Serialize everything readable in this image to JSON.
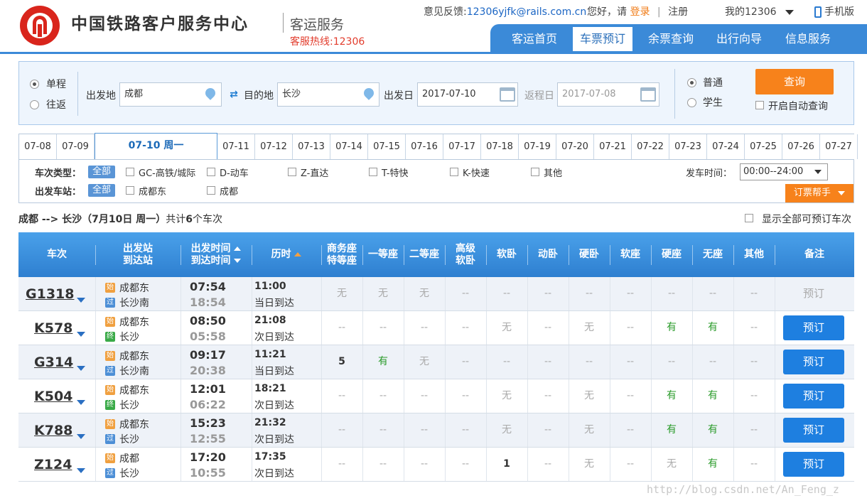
{
  "header": {
    "site_name": "中国铁路客户服务中心",
    "site_sub": "客运服务",
    "hotline": "客服热线:12306",
    "feedback_label": "意见反馈:",
    "feedback_email": "12306yjfk@rails.com.cn",
    "greeting": "您好，请",
    "login": "登录",
    "sep": "|",
    "register": "注册",
    "my": "我的12306",
    "mobile": "手机版",
    "nav": [
      "客运首页",
      "车票预订",
      "余票查询",
      "出行向导",
      "信息服务"
    ],
    "nav_active": 1
  },
  "query": {
    "single": "单程",
    "round": "往返",
    "from_label": "出发地",
    "from_value": "成都",
    "to_label": "目的地",
    "to_value": "长沙",
    "date_label": "出发日",
    "date_value": "2017-07-10",
    "return_label": "返程日",
    "return_value": "2017-07-08",
    "normal": "普通",
    "student": "学生",
    "search_btn": "查询",
    "auto_query": "开启自动查询"
  },
  "dates": [
    "07-08",
    "07-09",
    "07-10 周一",
    "07-11",
    "07-12",
    "07-13",
    "07-14",
    "07-15",
    "07-16",
    "07-17",
    "07-18",
    "07-19",
    "07-20",
    "07-21",
    "07-22",
    "07-23",
    "07-24",
    "07-25",
    "07-26",
    "07-27"
  ],
  "filters": {
    "type_label": "车次类型：",
    "all": "全部",
    "types": [
      "GC-高铁/城际",
      "D-动车",
      "Z-直达",
      "T-特快",
      "K-快速",
      "其他"
    ],
    "station_label": "出发车站：",
    "stations": [
      "成都东",
      "成都"
    ],
    "time_label": "发车时间：",
    "time_value": "00:00--24:00",
    "helper": "订票帮手"
  },
  "summary": {
    "route": "成都 --> 长沙",
    "date": "（7月10日  周一）",
    "count_pre": "共计",
    "count": "6",
    "count_post": "个车次",
    "show_all": "显示全部可预订车次"
  },
  "table": {
    "headers": {
      "train": "车次",
      "station1": "出发站",
      "station2": "到达站",
      "time1": "出发时间",
      "time2": "到达时间",
      "duration": "历时",
      "business1": "商务座",
      "business2": "特等座",
      "first": "一等座",
      "second": "二等座",
      "premium1": "高级",
      "premium2": "软卧",
      "soft_sleeper": "软卧",
      "dong_sleeper": "动卧",
      "hard_sleeper": "硬卧",
      "soft_seat": "软座",
      "hard_seat": "硬座",
      "no_seat": "无座",
      "other": "其他",
      "remark": "备注"
    },
    "rows": [
      {
        "no": "G1318",
        "from": "成都东",
        "to": "长沙南",
        "from_tag": "始",
        "to_tag": "过",
        "dep": "07:54",
        "arr": "18:54",
        "dur": "11:00",
        "day": "当日到达",
        "seats": [
          "无",
          "无",
          "无",
          "--",
          "--",
          "--",
          "--",
          "--",
          "--",
          "--",
          "--"
        ],
        "book": "预订",
        "bookable": false
      },
      {
        "no": "K578",
        "from": "成都东",
        "to": "长沙",
        "from_tag": "始",
        "to_tag": "终",
        "dep": "08:50",
        "arr": "05:58",
        "dur": "21:08",
        "day": "次日到达",
        "seats": [
          "--",
          "--",
          "--",
          "--",
          "无",
          "--",
          "无",
          "--",
          "有",
          "有",
          "--"
        ],
        "book": "预订",
        "bookable": true
      },
      {
        "no": "G314",
        "from": "成都东",
        "to": "长沙南",
        "from_tag": "始",
        "to_tag": "过",
        "dep": "09:17",
        "arr": "20:38",
        "dur": "11:21",
        "day": "当日到达",
        "seats": [
          "5",
          "有",
          "无",
          "--",
          "--",
          "--",
          "--",
          "--",
          "--",
          "--",
          "--"
        ],
        "book": "预订",
        "bookable": true
      },
      {
        "no": "K504",
        "from": "成都东",
        "to": "长沙",
        "from_tag": "始",
        "to_tag": "终",
        "dep": "12:01",
        "arr": "06:22",
        "dur": "18:21",
        "day": "次日到达",
        "seats": [
          "--",
          "--",
          "--",
          "--",
          "无",
          "--",
          "无",
          "--",
          "有",
          "有",
          "--"
        ],
        "book": "预订",
        "bookable": true
      },
      {
        "no": "K788",
        "from": "成都东",
        "to": "长沙",
        "from_tag": "始",
        "to_tag": "过",
        "dep": "15:23",
        "arr": "12:55",
        "dur": "21:32",
        "day": "次日到达",
        "seats": [
          "--",
          "--",
          "--",
          "--",
          "无",
          "--",
          "无",
          "--",
          "有",
          "有",
          "--"
        ],
        "book": "预订",
        "bookable": true
      },
      {
        "no": "Z124",
        "from": "成都",
        "to": "长沙",
        "from_tag": "始",
        "to_tag": "过",
        "dep": "17:20",
        "arr": "10:55",
        "dur": "17:35",
        "day": "次日到达",
        "seats": [
          "--",
          "--",
          "--",
          "--",
          "1",
          "--",
          "无",
          "--",
          "无",
          "有",
          "--"
        ],
        "book": "预订",
        "bookable": true
      }
    ]
  },
  "watermark": "http://blog.csdn.net/An_Feng_z"
}
